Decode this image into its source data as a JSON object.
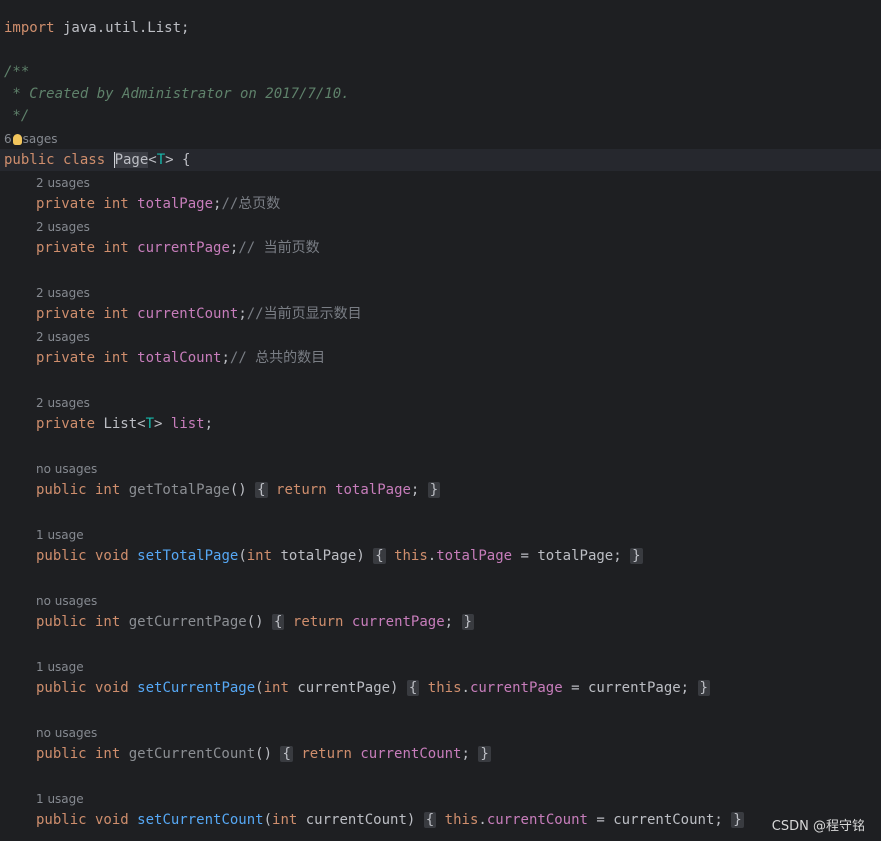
{
  "import": {
    "kw": "import",
    "path": " java.util.List;"
  },
  "javadoc": {
    "open": "/**",
    "body": " * Created by Administrator on 2017/7/10.",
    "close": " */"
  },
  "class_hint": {
    "pre": "6",
    "post": "sages"
  },
  "class_decl": {
    "kw": "public class ",
    "name": "Page",
    "type_open": "<",
    "type": "T",
    "type_close": "> {"
  },
  "fields": [
    {
      "hint": "2 usages",
      "kw": "private int ",
      "name": "totalPage",
      "semi": ";",
      "comment": "//总页数"
    },
    {
      "hint": "2 usages",
      "kw": "private int ",
      "name": "currentPage",
      "semi": ";",
      "comment": "// 当前页数"
    },
    {
      "hint": "2 usages",
      "kw": "private int ",
      "name": "currentCount",
      "semi": ";",
      "comment": "//当前页显示数目"
    },
    {
      "hint": "2 usages",
      "kw": "private int ",
      "name": "totalCount",
      "semi": ";",
      "comment": "// 总共的数目"
    }
  ],
  "list_field": {
    "hint": "2 usages",
    "kw": "private ",
    "type": "List<",
    "tparam": "T",
    "type_close": "> ",
    "name": "list",
    "semi": ";"
  },
  "methods": [
    {
      "hint": "no usages",
      "kw": "public int ",
      "name": "getTotalPage",
      "sig": "()",
      "ob": "{",
      "body_kw": "return ",
      "body_fld": "totalPage",
      "body_end": ";",
      "cb": "}"
    },
    {
      "hint": "1 usage",
      "kw": "public void ",
      "name": "setTotalPage",
      "sig_open": "(",
      "param_kw": "int",
      "param": " totalPage)",
      "ob": "{",
      "this": "this",
      "dot": ".",
      "fld": "totalPage",
      "assign": " = totalPage;",
      "cb": "}"
    },
    {
      "hint": "no usages",
      "kw": "public int ",
      "name": "getCurrentPage",
      "sig": "()",
      "ob": "{",
      "body_kw": "return ",
      "body_fld": "currentPage",
      "body_end": ";",
      "cb": "}"
    },
    {
      "hint": "1 usage",
      "kw": "public void ",
      "name": "setCurrentPage",
      "sig_open": "(",
      "param_kw": "int",
      "param": " currentPage)",
      "ob": "{",
      "this": "this",
      "dot": ".",
      "fld": "currentPage",
      "assign": " = currentPage;",
      "cb": "}"
    },
    {
      "hint": "no usages",
      "kw": "public int ",
      "name": "getCurrentCount",
      "sig": "()",
      "ob": "{",
      "body_kw": "return ",
      "body_fld": "currentCount",
      "body_end": ";",
      "cb": "}"
    },
    {
      "hint": "1 usage",
      "kw": "public void ",
      "name": "setCurrentCount",
      "sig_open": "(",
      "param_kw": "int",
      "param": " currentCount)",
      "ob": "{",
      "this": "this",
      "dot": ".",
      "fld": "currentCount",
      "assign": " = currentCount;",
      "cb": "}"
    }
  ],
  "watermark": "CSDN @程守铭",
  "colors": {
    "background": "#1e1f22",
    "keyword": "#cf8e6d",
    "field": "#c77dbb",
    "method": "#56a8f5",
    "type_param": "#16baac",
    "doc_comment": "#5f826b",
    "comment": "#7a7e85"
  }
}
